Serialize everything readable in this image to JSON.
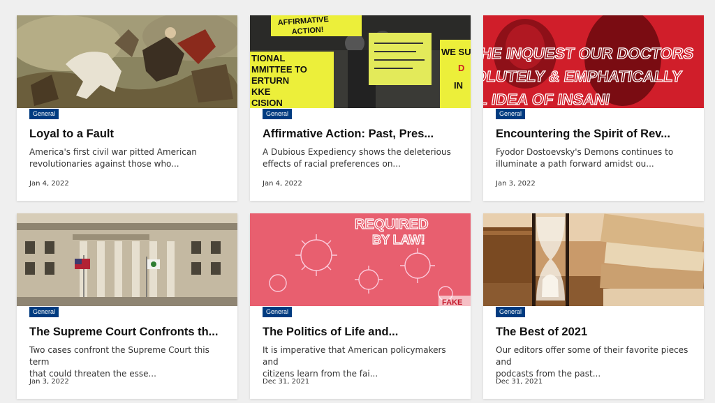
{
  "articles": [
    {
      "category": "General",
      "title": "Loyal to a Fault",
      "excerpt_line1": "America's first civil war pitted American",
      "excerpt_line2": "revolutionaries against those who...",
      "date": "Jan 4, 2022",
      "image": "painting-battle-horses"
    },
    {
      "category": "General",
      "title": "Affirmative Action: Past, Pres...",
      "excerpt_line1": "A Dubious Expediency shows the deleterious",
      "excerpt_line2": "effects of racial preferences on...",
      "date": "Jan 4, 2022",
      "image": "protest-signs-yellow",
      "image_text": [
        "AFFIRMATIVE",
        "ACTION!",
        "TIONAL",
        "MMITTEE TO",
        "ERTURN",
        "KKE",
        "CISION",
        "WE SU",
        "D",
        "IN"
      ]
    },
    {
      "category": "General",
      "title": "Encountering the Spirit of Rev...",
      "excerpt_line1": "Fyodor Dostoevsky's Demons continues to",
      "excerpt_line2": "illuminate a path forward amidst ou...",
      "date": "Jan 3, 2022",
      "image": "red-text-portrait",
      "image_text": [
        "HE INQUEST OUR DOCTORS",
        "OLUTELY & EMPHATICALLY",
        "L IDEA OF INSANI"
      ]
    },
    {
      "category": "General",
      "title": "The Supreme Court Confronts th...",
      "excerpt_line1": "Two cases confront the Supreme Court this term",
      "excerpt_line2": "that could threaten the esse...",
      "date": "Jan 3, 2022",
      "image": "government-building-columns"
    },
    {
      "category": "General",
      "title": "The Politics of Life and...",
      "excerpt_line1": "It is imperative that American policymakers and",
      "excerpt_line2": "citizens learn from the fai...",
      "date": "Dec 31, 2021",
      "image": "red-virus-text",
      "image_text": [
        "REQUIRED",
        "BY LAW!",
        "FAKE"
      ]
    },
    {
      "category": "General",
      "title": "The Best of 2021",
      "excerpt_line1": "Our editors offer some of their favorite pieces and",
      "excerpt_line2": "podcasts from the past...",
      "date": "Dec 31, 2021",
      "image": "hourglass-books"
    }
  ]
}
